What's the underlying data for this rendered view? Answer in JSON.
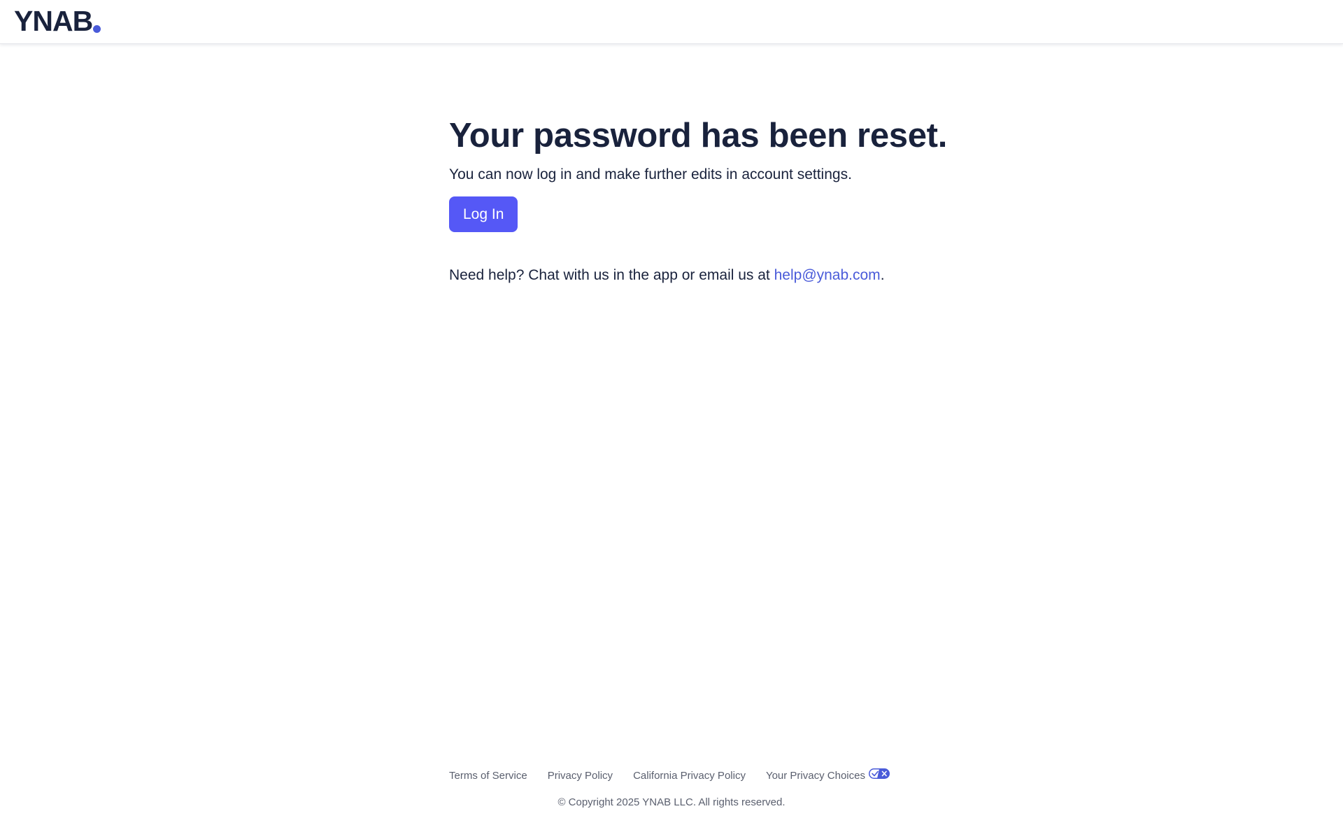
{
  "colors": {
    "brand": "#19223c",
    "accent": "#5558f6",
    "link": "#4a5bd9",
    "logo_dot": "#4a5bd9",
    "muted": "#5a5f6e"
  },
  "header": {
    "logo_text": "YNAB",
    "logo_icon": "logo-dot-icon"
  },
  "main": {
    "title": "Your password has been reset.",
    "subtitle": "You can now log in and make further edits in account settings.",
    "login_button_label": "Log In",
    "help_prefix": "Need help? Chat with us in the app or email us at ",
    "help_email": "help@ynab.com",
    "help_suffix": "."
  },
  "footer": {
    "links": [
      {
        "label": "Terms of Service"
      },
      {
        "label": "Privacy Policy"
      },
      {
        "label": "California Privacy Policy"
      },
      {
        "label": "Your Privacy Choices",
        "icon": "privacy-choices-toggle-icon"
      }
    ],
    "copyright": "© Copyright 2025 YNAB LLC. All rights reserved."
  }
}
